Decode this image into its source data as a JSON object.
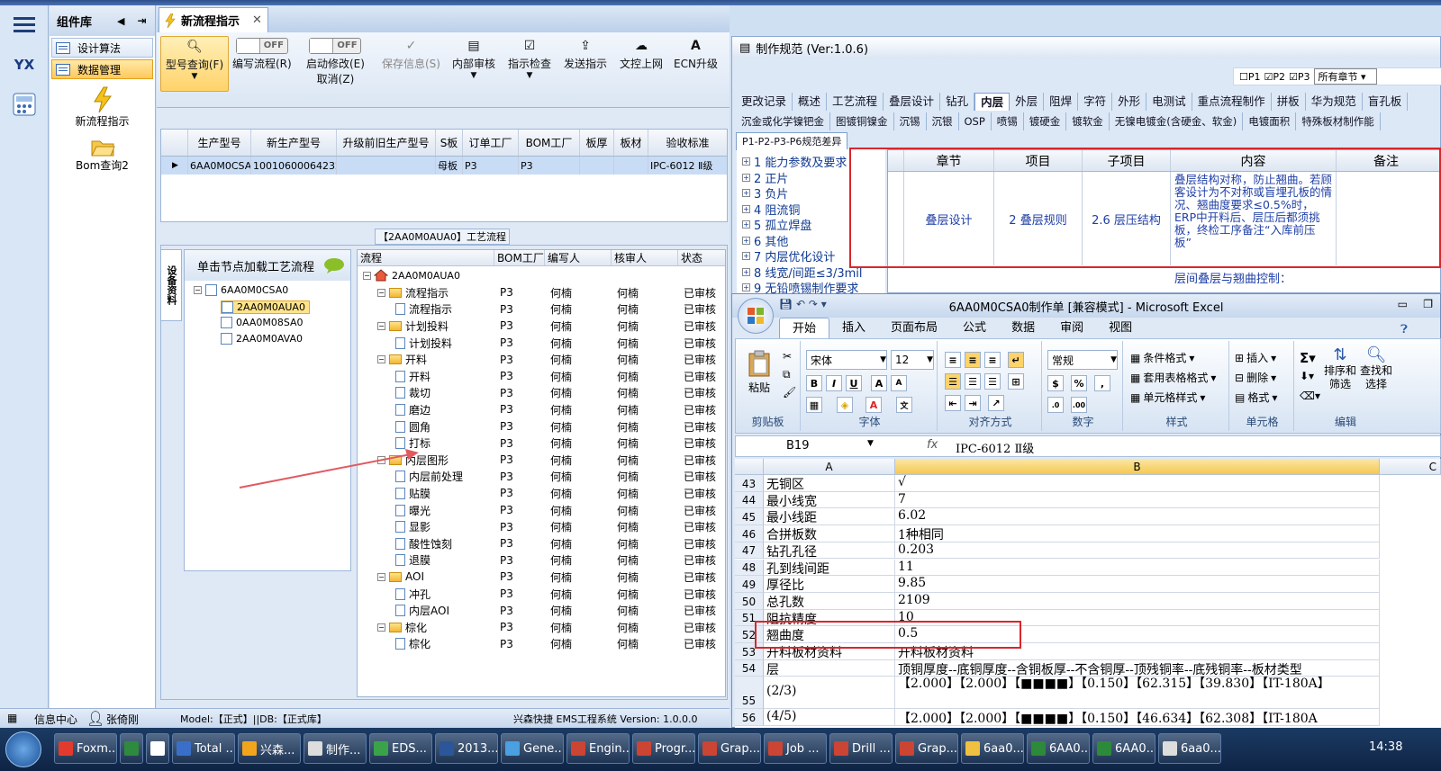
{
  "window": {
    "top_right": "Style"
  },
  "leftnav": {
    "logo": "YX"
  },
  "complib": {
    "title": "组件库",
    "items": [
      {
        "label": "设计算法"
      },
      {
        "label": "数据管理"
      }
    ],
    "icons": [
      {
        "label": "新流程指示"
      },
      {
        "label": "Bom查询2"
      }
    ]
  },
  "tab": {
    "label": "新流程指示"
  },
  "ribbon": {
    "buttons": [
      {
        "label": "型号查询(F)"
      },
      {
        "label": "编写流程(R)",
        "toggle": "OFF"
      },
      {
        "label": "启动修改(E)",
        "sub": "取消(Z)",
        "toggle": "OFF"
      },
      {
        "label": "保存信息(S)"
      },
      {
        "label": "内部审核"
      },
      {
        "label": "指示检查"
      },
      {
        "label": "发送指示"
      },
      {
        "label": "文控上网"
      },
      {
        "label": "ECN升级"
      }
    ]
  },
  "grid1": {
    "headers": [
      "生产型号",
      "新生产型号",
      "升级前旧生产型号",
      "S板",
      "订单工厂",
      "BOM工厂",
      "板厚",
      "板材",
      "验收标准"
    ],
    "row": [
      "6AA0M0CSA0",
      "10010600064232",
      "",
      "母板",
      "P3",
      "P3",
      "",
      "",
      "IPC-6012 Ⅱ级"
    ]
  },
  "process_title": "【2AA0M0AUA0】工艺流程",
  "side_tab": "设备资料",
  "left_tree": {
    "header": "单击节点加载工艺流程",
    "nodes": [
      {
        "label": "6AA0M0CSA0"
      },
      {
        "label": "2AA0M0AUA0"
      },
      {
        "label": "0AA0M08SA0"
      },
      {
        "label": "2AA0M0AVA0"
      }
    ]
  },
  "ptable": {
    "headers": [
      "流程",
      "BOM工厂",
      "编写人",
      "核审人",
      "状态"
    ],
    "root": "2AA0M0AUA0",
    "rows": [
      {
        "name": "流程指示",
        "type": "folder",
        "level": 1,
        "bom": "P3",
        "writer": "何楠",
        "reviewer": "何楠",
        "status": "已审核"
      },
      {
        "name": "流程指示",
        "type": "doc",
        "level": 2,
        "bom": "P3",
        "writer": "何楠",
        "reviewer": "何楠",
        "status": "已审核"
      },
      {
        "name": "计划投料",
        "type": "folder",
        "level": 1,
        "bom": "P3",
        "writer": "何楠",
        "reviewer": "何楠",
        "status": "已审核"
      },
      {
        "name": "计划投料",
        "type": "doc",
        "level": 2,
        "bom": "P3",
        "writer": "何楠",
        "reviewer": "何楠",
        "status": "已审核"
      },
      {
        "name": "开料",
        "type": "folder",
        "level": 1,
        "bom": "P3",
        "writer": "何楠",
        "reviewer": "何楠",
        "status": "已审核"
      },
      {
        "name": "开料",
        "type": "doc",
        "level": 2,
        "bom": "P3",
        "writer": "何楠",
        "reviewer": "何楠",
        "status": "已审核"
      },
      {
        "name": "裁切",
        "type": "doc",
        "level": 2,
        "bom": "P3",
        "writer": "何楠",
        "reviewer": "何楠",
        "status": "已审核"
      },
      {
        "name": "磨边",
        "type": "doc",
        "level": 2,
        "bom": "P3",
        "writer": "何楠",
        "reviewer": "何楠",
        "status": "已审核"
      },
      {
        "name": "圆角",
        "type": "doc",
        "level": 2,
        "bom": "P3",
        "writer": "何楠",
        "reviewer": "何楠",
        "status": "已审核"
      },
      {
        "name": "打标",
        "type": "doc",
        "level": 2,
        "bom": "P3",
        "writer": "何楠",
        "reviewer": "何楠",
        "status": "已审核"
      },
      {
        "name": "内层图形",
        "type": "folder",
        "level": 1,
        "bom": "P3",
        "writer": "何楠",
        "reviewer": "何楠",
        "status": "已审核"
      },
      {
        "name": "内层前处理",
        "type": "doc",
        "level": 2,
        "bom": "P3",
        "writer": "何楠",
        "reviewer": "何楠",
        "status": "已审核"
      },
      {
        "name": "贴膜",
        "type": "doc",
        "level": 2,
        "bom": "P3",
        "writer": "何楠",
        "reviewer": "何楠",
        "status": "已审核"
      },
      {
        "name": "曝光",
        "type": "doc",
        "level": 2,
        "bom": "P3",
        "writer": "何楠",
        "reviewer": "何楠",
        "status": "已审核"
      },
      {
        "name": "显影",
        "type": "doc",
        "level": 2,
        "bom": "P3",
        "writer": "何楠",
        "reviewer": "何楠",
        "status": "已审核"
      },
      {
        "name": "酸性蚀刻",
        "type": "doc",
        "level": 2,
        "bom": "P3",
        "writer": "何楠",
        "reviewer": "何楠",
        "status": "已审核"
      },
      {
        "name": "退膜",
        "type": "doc",
        "level": 2,
        "bom": "P3",
        "writer": "何楠",
        "reviewer": "何楠",
        "status": "已审核"
      },
      {
        "name": "AOI",
        "type": "folder",
        "level": 1,
        "bom": "P3",
        "writer": "何楠",
        "reviewer": "何楠",
        "status": "已审核"
      },
      {
        "name": "冲孔",
        "type": "doc",
        "level": 2,
        "bom": "P3",
        "writer": "何楠",
        "reviewer": "何楠",
        "status": "已审核"
      },
      {
        "name": "内层AOI",
        "type": "doc",
        "level": 2,
        "bom": "P3",
        "writer": "何楠",
        "reviewer": "何楠",
        "status": "已审核"
      },
      {
        "name": "棕化",
        "type": "folder",
        "level": 1,
        "bom": "P3",
        "writer": "何楠",
        "reviewer": "何楠",
        "status": "已审核"
      },
      {
        "name": "棕化",
        "type": "doc",
        "level": 2,
        "bom": "P3",
        "writer": "何楠",
        "reviewer": "何楠",
        "status": "已审核"
      }
    ]
  },
  "statusbar": {
    "info": "信息中心",
    "user": "张倚刚",
    "model": "Model:【正式】||DB:【正式库】",
    "system": "兴森快捷 EMS工程系统 Version: 1.0.0.0"
  },
  "spec": {
    "title": "制作规范 (Ver:1.0.6)",
    "checks": [
      "P1",
      "P2",
      "P3"
    ],
    "select": "所有章节",
    "tabs1": [
      "更改记录",
      "概述",
      "工艺流程",
      "叠层设计",
      "钻孔",
      "内层",
      "外层",
      "阻焊",
      "字符",
      "外形",
      "电测试",
      "重点流程制作",
      "拼板",
      "华为规范",
      "盲孔板"
    ],
    "tabs2": [
      "沉金或化学镍钯金",
      "图镀铜镍金",
      "沉锡",
      "沉银",
      "OSP",
      "喷锡",
      "镀硬金",
      "镀软金",
      "无镍电镀金(含硬金、软金)",
      "电镀面积",
      "特殊板材制作能"
    ],
    "tab3": "P1-P2-P3-P6规范差异",
    "chapters": [
      "1 能力参数及要求",
      "2 正片",
      "3 负片",
      "4 阻流铜",
      "5 孤立焊盘",
      "6 其他",
      "7 内层优化设计",
      "8 线宽/间距≤3/3mil",
      "9 无铅喷锡制作要求"
    ],
    "grid_headers": [
      "章节",
      "项目",
      "子项目",
      "内容",
      "备注"
    ],
    "grid_row": {
      "chapter": "叠层设计",
      "item": "2 叠层规则",
      "subitem": "2.6 层压结构",
      "content": "叠层结构对称，防止翘曲。若顾客设计为不对称或盲埋孔板的情况、翘曲度要求≤0.5%时，ERP中开料后、层压后都须挑板，终检工序备注“入库前压板”"
    },
    "next_content": "层间叠层与翘曲控制："
  },
  "excel": {
    "title": "6AA0M0CSA0制作单 [兼容模式] - Microsoft Excel",
    "tabs": [
      "开始",
      "插入",
      "页面布局",
      "公式",
      "数据",
      "审阅",
      "视图"
    ],
    "font": "宋体",
    "size": "12",
    "number_format": "常规",
    "groups": [
      "剪贴板",
      "字体",
      "对齐方式",
      "数字",
      "样式",
      "单元格",
      "编辑"
    ],
    "paste": "粘贴",
    "styles": [
      "条件格式",
      "套用表格格式",
      "单元格样式"
    ],
    "cells": [
      "插入",
      "删除",
      "格式"
    ],
    "edit": [
      "排序和筛选",
      "查找和选择"
    ],
    "namebox": "B19",
    "fx": "IPC-6012 Ⅱ级",
    "cols": [
      "A",
      "B",
      "C"
    ],
    "rows": [
      {
        "n": "43",
        "a": "无铜区",
        "b": "√"
      },
      {
        "n": "44",
        "a": "最小线宽",
        "b": "7"
      },
      {
        "n": "45",
        "a": "最小线距",
        "b": "6.02"
      },
      {
        "n": "46",
        "a": "合拼板数",
        "b": "1种相同"
      },
      {
        "n": "47",
        "a": "钻孔孔径",
        "b": "0.203"
      },
      {
        "n": "48",
        "a": "孔到线间距",
        "b": "11"
      },
      {
        "n": "49",
        "a": "厚径比",
        "b": "9.85"
      },
      {
        "n": "50",
        "a": "总孔数",
        "b": "2109"
      },
      {
        "n": "51",
        "a": "阻抗精度",
        "b": "10"
      },
      {
        "n": "52",
        "a": "翘曲度",
        "b": "0.5"
      },
      {
        "n": "53",
        "a": "开料板材资料",
        "b": "开料板材资料"
      },
      {
        "n": "54",
        "a": "层",
        "b": "顶铜厚度--底铜厚度--含铜板厚--不含铜厚--顶残铜率--底残铜率--板材类型"
      },
      {
        "n": "55",
        "a": "(2/3)",
        "b": "【2.000】【2.000】【■■■■】【0.150】【62.315】【39.830】【IT-180A】"
      },
      {
        "n": "56",
        "a": "(4/5)",
        "b": "【2.000】【2.000】【■■■■】【0.150】【46.634】【62.308】【IT-180A"
      }
    ]
  },
  "taskbar": {
    "items": [
      "Foxm...",
      "",
      "",
      "Total ...",
      "兴森...",
      "制作...",
      "EDS...",
      "2013...",
      "Gene...",
      "Engin...",
      "Progr...",
      "Grap...",
      "Job ...",
      "Drill ...",
      "Grap...",
      "6aa0...",
      "6AA0...",
      "6AA0...",
      "6aa0..."
    ],
    "clock": "14:38"
  }
}
